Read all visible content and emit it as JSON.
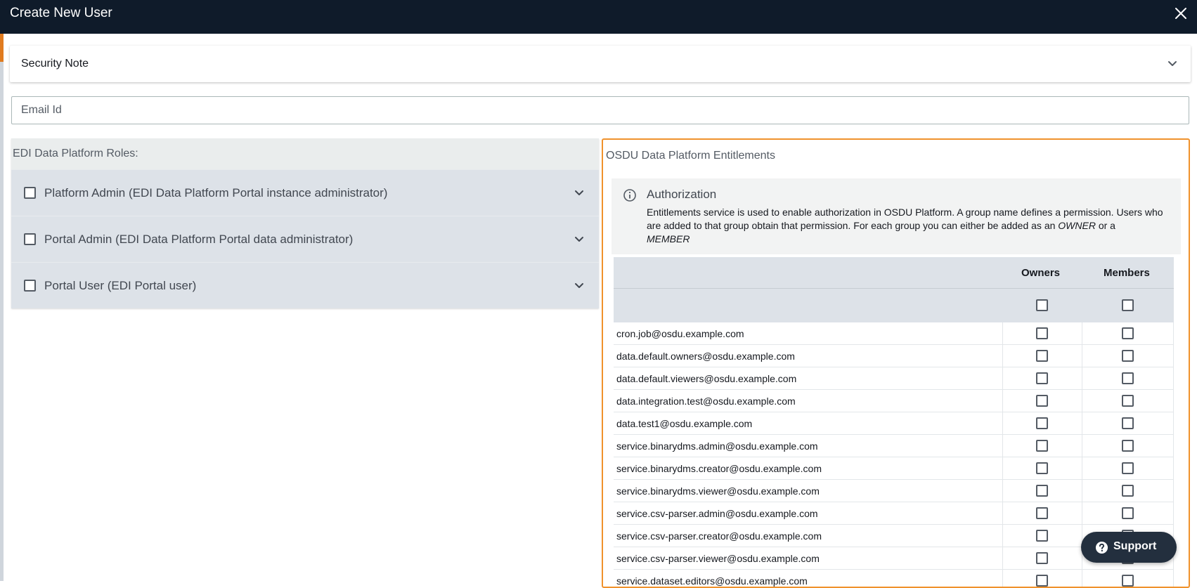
{
  "dialog": {
    "title": "Create New User",
    "close_icon": "close-icon"
  },
  "security_note": {
    "label": "Security Note",
    "icon": "chevron-down-icon"
  },
  "email": {
    "placeholder": "Email Id",
    "value": ""
  },
  "roles": {
    "heading": "EDI Data Platform Roles:",
    "items": [
      {
        "label": "Platform Admin (EDI Data Platform Portal instance administrator)",
        "checked": false
      },
      {
        "label": "Portal Admin (EDI Data Platform Portal data administrator)",
        "checked": false
      },
      {
        "label": "Portal User (EDI Portal user)",
        "checked": false
      }
    ]
  },
  "entitlements": {
    "heading": "OSDU Data Platform Entitlements",
    "auth": {
      "title": "Authorization",
      "text_prefix": "Entitlements service is used to enable authorization in OSDU Platform. A group name defines a permission. Users who are added to that group obtain that permission. For each group you can either be added as an ",
      "owner_word": "OWNER",
      "text_middle": " or a ",
      "member_word": "MEMBER"
    },
    "columns": {
      "owners": "Owners",
      "members": "Members"
    },
    "rows": [
      "cron.job@osdu.example.com",
      "data.default.owners@osdu.example.com",
      "data.default.viewers@osdu.example.com",
      "data.integration.test@osdu.example.com",
      "data.test1@osdu.example.com",
      "service.binarydms.admin@osdu.example.com",
      "service.binarydms.creator@osdu.example.com",
      "service.binarydms.viewer@osdu.example.com",
      "service.csv-parser.admin@osdu.example.com",
      "service.csv-parser.creator@osdu.example.com",
      "service.csv-parser.viewer@osdu.example.com",
      "service.dataset.editors@osdu.example.com"
    ]
  },
  "support": {
    "label": "Support",
    "icon": "help-circle-icon"
  },
  "colors": {
    "titlebar": "#0f1b2a",
    "accent_orange": "#f0922c",
    "role_bg": "#dde2e8"
  }
}
